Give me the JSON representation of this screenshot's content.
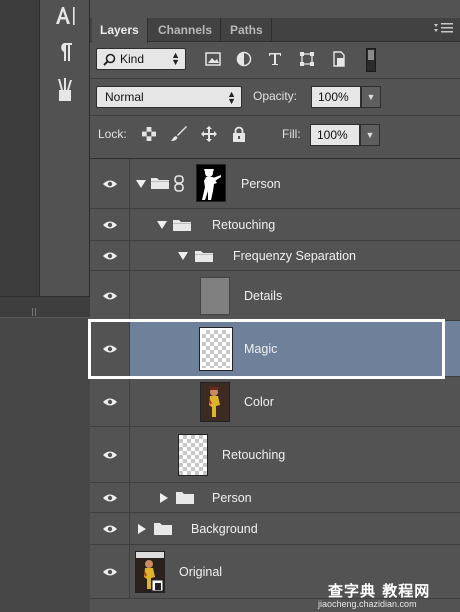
{
  "tools": {
    "items": [
      {
        "name": "type-tool"
      },
      {
        "name": "paragraph-tool"
      },
      {
        "name": "brush-presets-tool"
      }
    ]
  },
  "panel": {
    "tabs": [
      {
        "label": "Layers",
        "active": true
      },
      {
        "label": "Channels",
        "active": false
      },
      {
        "label": "Paths",
        "active": false
      }
    ],
    "filter": {
      "kind_label": "Kind",
      "icons": [
        "image-filter-icon",
        "adjustment-filter-icon",
        "type-filter-icon",
        "shape-filter-icon",
        "smart-object-filter-icon"
      ]
    },
    "blend": {
      "mode": "Normal",
      "opacity_label": "Opacity:",
      "opacity": "100%"
    },
    "lock": {
      "label": "Lock:",
      "fill_label": "Fill:",
      "fill": "100%"
    }
  },
  "layers": [
    {
      "name": "Person",
      "type": "group-with-mask",
      "expanded": true,
      "indent": 0,
      "selected": false
    },
    {
      "name": "Retouching",
      "type": "group",
      "expanded": true,
      "indent": 1,
      "selected": false
    },
    {
      "name": "Frequenzy Separation",
      "type": "group",
      "expanded": true,
      "indent": 2,
      "selected": false
    },
    {
      "name": "Details",
      "type": "layer",
      "thumb": "gray",
      "indent": 3,
      "selected": false
    },
    {
      "name": "Magic",
      "type": "layer",
      "thumb": "transparent",
      "indent": 3,
      "selected": true
    },
    {
      "name": "Color",
      "type": "layer",
      "thumb": "photo",
      "indent": 3,
      "selected": false
    },
    {
      "name": "Retouching",
      "type": "layer",
      "thumb": "transparent",
      "indent": 1,
      "selected": false
    },
    {
      "name": "Person",
      "type": "group",
      "expanded": false,
      "indent": 1,
      "selected": false
    },
    {
      "name": "Background",
      "type": "group",
      "expanded": false,
      "indent": 0,
      "selected": false
    },
    {
      "name": "Original",
      "type": "smart-object",
      "thumb": "photo",
      "indent": 0,
      "selected": false
    }
  ],
  "watermark": {
    "title": "查字典 教程网",
    "url": "jiaocheng.chazidian.com"
  },
  "colors": {
    "panel_bg": "#535353",
    "selected_row": "#6f809a",
    "highlight_frame": "#ffffff"
  }
}
